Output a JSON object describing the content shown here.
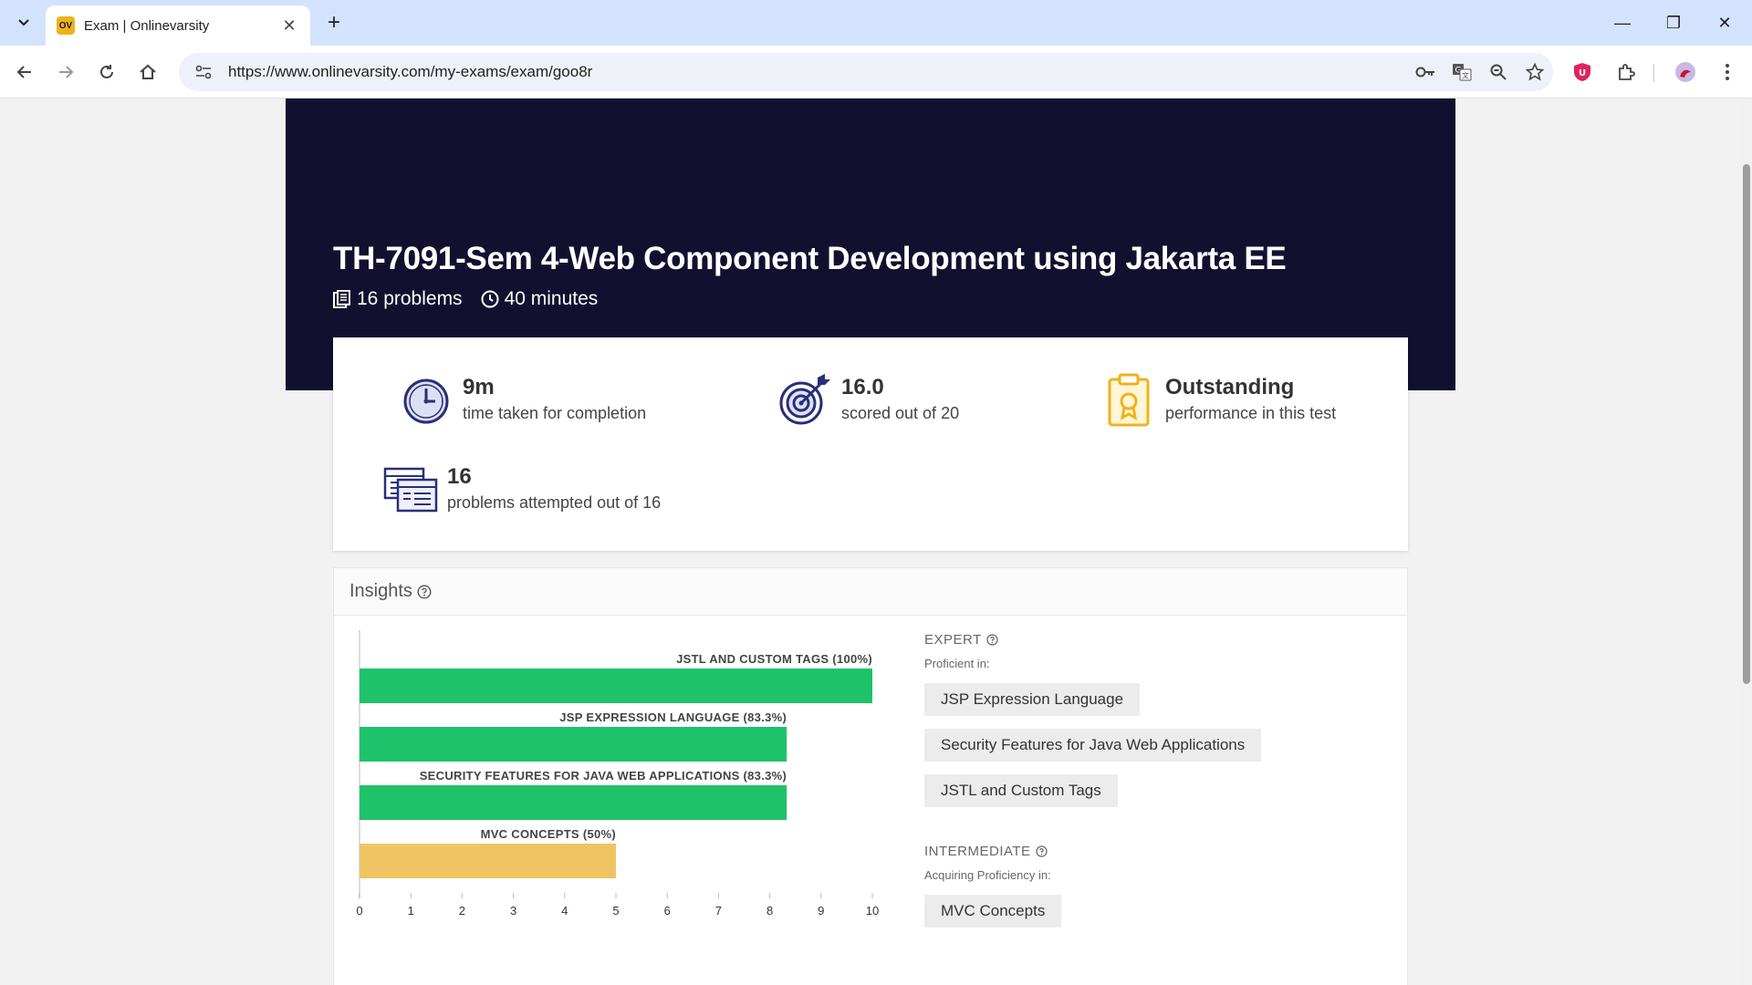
{
  "browser": {
    "tab_title": "Exam | Onlinevarsity",
    "favicon_text": "OV",
    "url": "https://www.onlinevarsity.com/my-exams/exam/goo8r"
  },
  "exam": {
    "title": "TH-7091-Sem 4-Web Component Development using Jakarta EE",
    "problems": "16 problems",
    "duration": "40 minutes"
  },
  "stats": {
    "time": {
      "value": "9m",
      "label": "time taken for completion"
    },
    "score": {
      "value": "16.0",
      "label": "scored out of 20"
    },
    "performance": {
      "value": "Outstanding",
      "label": "performance in this test"
    },
    "attempted": {
      "value": "16",
      "label": "problems attempted out of 16"
    }
  },
  "insights": {
    "title": "Insights",
    "expert": {
      "title": "EXPERT",
      "subtitle": "Proficient in:",
      "skills": [
        "JSP Expression Language",
        "Security Features for Java Web Applications",
        "JSTL and Custom Tags"
      ]
    },
    "intermediate": {
      "title": "INTERMEDIATE",
      "subtitle": "Acquiring Proficiency in:",
      "skills": [
        "MVC Concepts"
      ]
    }
  },
  "chart_data": {
    "type": "bar",
    "orientation": "horizontal",
    "categories": [
      "JSTL AND CUSTOM TAGS (100%)",
      "JSP EXPRESSION LANGUAGE (83.3%)",
      "SECURITY FEATURES FOR JAVA WEB APPLICATIONS (83.3%)",
      "MVC CONCEPTS (50%)"
    ],
    "values": [
      10,
      8.33,
      8.33,
      5
    ],
    "colors": [
      "#1ec26a",
      "#1ec26a",
      "#1ec26a",
      "#f0c462"
    ],
    "xlim": [
      0,
      10
    ],
    "xticks": [
      "0",
      "1",
      "2",
      "3",
      "4",
      "5",
      "6",
      "7",
      "8",
      "9",
      "10"
    ]
  },
  "colors": {
    "hero_bg": "#11112f",
    "bar_green": "#1ec26a",
    "bar_amber": "#f0c462",
    "icon_navy": "#2a2f78",
    "icon_gold": "#f0b21a"
  }
}
